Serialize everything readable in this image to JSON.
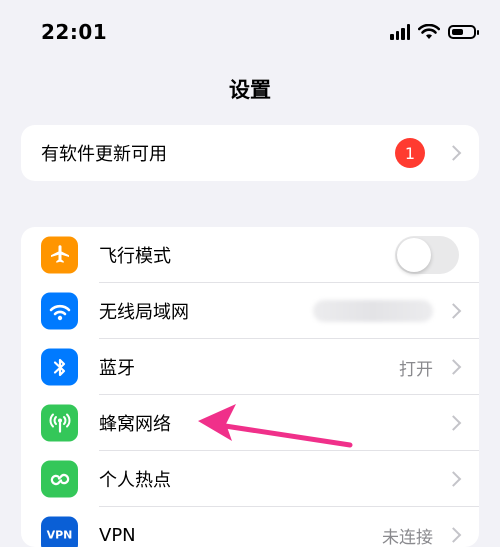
{
  "status": {
    "time": "22:01",
    "battery_level": 0.55
  },
  "nav": {
    "title": "设置"
  },
  "update_group": {
    "label": "有软件更新可用",
    "badge": "1"
  },
  "rows": [
    {
      "label": "飞行模式",
      "icon": "airplane-icon",
      "color": "#ff9500",
      "value": "",
      "toggle": false
    },
    {
      "label": "无线局域网",
      "icon": "wifi-icon",
      "color": "#007aff",
      "value": "",
      "blurred": true
    },
    {
      "label": "蓝牙",
      "icon": "bluetooth-icon",
      "color": "#007aff",
      "value": "打开"
    },
    {
      "label": "蜂窝网络",
      "icon": "cellular-antenna-icon",
      "color": "#34c759",
      "value": ""
    },
    {
      "label": "个人热点",
      "icon": "hotspot-link-icon",
      "color": "#34c759",
      "value": ""
    },
    {
      "label": "VPN",
      "icon": "vpn-icon",
      "color": "#0a5fd6",
      "value": "未连接"
    }
  ],
  "annotation": {
    "arrow_color": "#f0308a"
  }
}
